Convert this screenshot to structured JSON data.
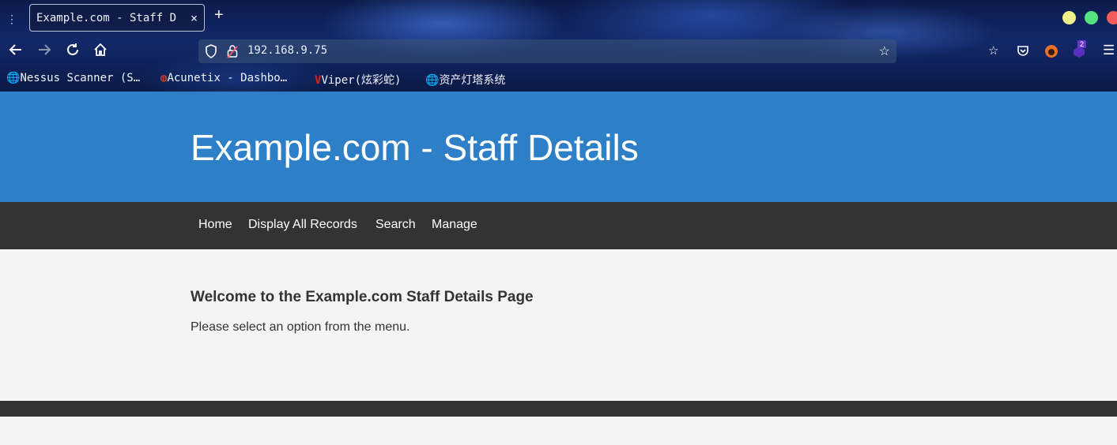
{
  "browser": {
    "tab_title": "Example.com - Staff D",
    "tab_close": "×",
    "new_tab": "+",
    "url": "192.168.9.75",
    "extension_badge": "2",
    "bookmarks": [
      {
        "label": "Nessus Scanner (S…",
        "icon": "globe-icon"
      },
      {
        "label": "Acunetix - Dashbo…",
        "icon": "acunetix-icon"
      },
      {
        "label": "Viper(炫彩蛇)",
        "icon": "viper-icon"
      },
      {
        "label": "资产灯塔系统",
        "icon": "globe-icon"
      }
    ]
  },
  "page": {
    "header_title": "Example.com - Staff Details",
    "nav": [
      "Home",
      "Display All Records",
      "Search",
      "Manage"
    ],
    "welcome_heading": "Welcome to the Example.com Staff Details Page",
    "welcome_text": "Please select an option from the menu."
  },
  "colors": {
    "header_bg": "#2d80c8",
    "navbar_bg": "#333333",
    "content_bg": "#f4f4f4"
  }
}
